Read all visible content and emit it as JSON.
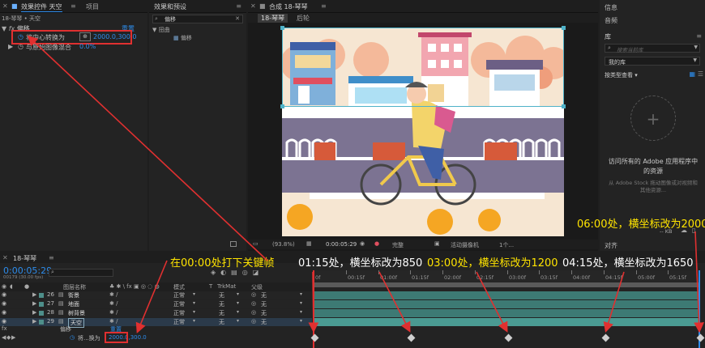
{
  "left_panel": {
    "tabs": [
      "效果控件 天空",
      "项目"
    ],
    "breadcrumb": "18-琴琴 • 天空",
    "effect_name": "偏移",
    "effect_reset": "重置",
    "prop1_label": "将中心转换为",
    "prop1_value": "2000.0,300.0",
    "prop2_label": "与原始图像混合",
    "prop2_value": "0.0%"
  },
  "effects_panel": {
    "title": "效果和预设",
    "search_value": "偏移",
    "category": "扭曲",
    "item": "偏移"
  },
  "composition": {
    "title": "合成 18-琴琴",
    "tabs": [
      "18-琴琴",
      "后轮"
    ],
    "zoom": "(93.8%)",
    "timecode": "0:00:05:29",
    "quality": "完整",
    "camera": "活动摄像机",
    "views": "1个..."
  },
  "right_panel": {
    "items": [
      "信息",
      "音频"
    ],
    "library_title": "库",
    "search_placeholder": "搜索当前库",
    "my_library": "我的库",
    "view_by_type": "按类型查看",
    "empty_title": "访问所有的 Adobe 应用程序中的资源",
    "empty_desc": "从 Adobe Stock 拖动图像或对视频和其他资源...",
    "kb": "-- KB",
    "align": "对齐"
  },
  "timeline": {
    "tab": "18-琴琴",
    "timecode": "0:00:05:29",
    "frames": "00179 (30.00 fps)",
    "columns": {
      "name": "图层名称",
      "mode": "模式",
      "t": "T",
      "trkmat": "TrkMat",
      "parent": "父级"
    },
    "layers": [
      {
        "num": "26",
        "name": "街景",
        "mode": "正常",
        "trk": "无",
        "parent": "无",
        "color": "#4e8f8a"
      },
      {
        "num": "27",
        "name": "地面",
        "mode": "正常",
        "trk": "无",
        "parent": "无",
        "color": "#4e8f8a"
      },
      {
        "num": "28",
        "name": "树背景",
        "mode": "正常",
        "trk": "无",
        "parent": "无",
        "color": "#4e8f8a"
      },
      {
        "num": "29",
        "name": "天空",
        "mode": "正常",
        "trk": "无",
        "parent": "无",
        "color": "#4e8f8a"
      }
    ],
    "effect_row": "偏移",
    "effect_reset": "重置",
    "prop_label": "将...换为",
    "prop_value": "2000.0,300.0",
    "ruler": [
      "0f",
      "00:15f",
      "01:00f",
      "01:15f",
      "02:00f",
      "02:15f",
      "03:00f",
      "03:15f",
      "04:00f",
      "04:15f",
      "05:00f",
      "05:15f"
    ]
  },
  "annotations": {
    "a0": "在00:00处打下关键帧",
    "a1": "01:15处，横坐标改为850",
    "a2": "03:00处，横坐标改为1200",
    "a3": "04:15处，横坐标改为1650",
    "a4": "06:00处，横坐标改为2000"
  },
  "colors": {
    "accent": "#2d8ceb",
    "annotation": "#ffe400",
    "highlight": "#e03030",
    "panel": "#232323"
  }
}
